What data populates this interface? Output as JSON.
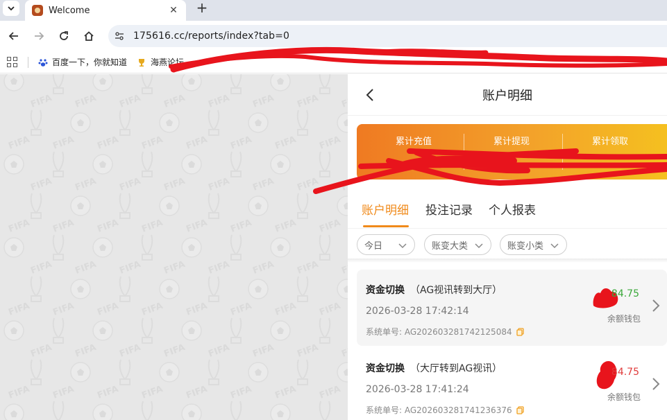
{
  "browser": {
    "tab_title": "Welcome",
    "url": "175616.cc/reports/index?tab=0",
    "bookmarks": [
      {
        "label": "百度一下，你就知道"
      },
      {
        "label": "海燕论坛"
      }
    ]
  },
  "page": {
    "title": "账户明细",
    "stats": [
      {
        "label": "累计充值"
      },
      {
        "label": "累计提现"
      },
      {
        "label": "累计领取"
      }
    ],
    "tabs": [
      {
        "label": "账户明细",
        "active": true
      },
      {
        "label": "投注记录",
        "active": false
      },
      {
        "label": "个人报表",
        "active": false
      }
    ],
    "filters": [
      {
        "label": "今日"
      },
      {
        "label": "账变大类"
      },
      {
        "label": "账变小类"
      }
    ],
    "records": [
      {
        "type": "资金切换",
        "desc": "（AG视讯转到大厅）",
        "time": "2026-03-28 17:42:14",
        "order_label": "系统单号:",
        "order_no": "AG202603281742125084",
        "amount": "84.75",
        "amount_color": "#3aa83a",
        "wallet": "余额钱包"
      },
      {
        "type": "资金切换",
        "desc": "（大厅转到AG视讯）",
        "time": "2026-03-28 17:41:24",
        "order_label": "系统单号:",
        "order_no": "AG202603281741236376",
        "amount": "84.75",
        "amount_color": "#e03b3b",
        "wallet": "余额钱包"
      }
    ]
  },
  "colors": {
    "accent": "#f08a1a",
    "redaction": "#e8141c"
  }
}
